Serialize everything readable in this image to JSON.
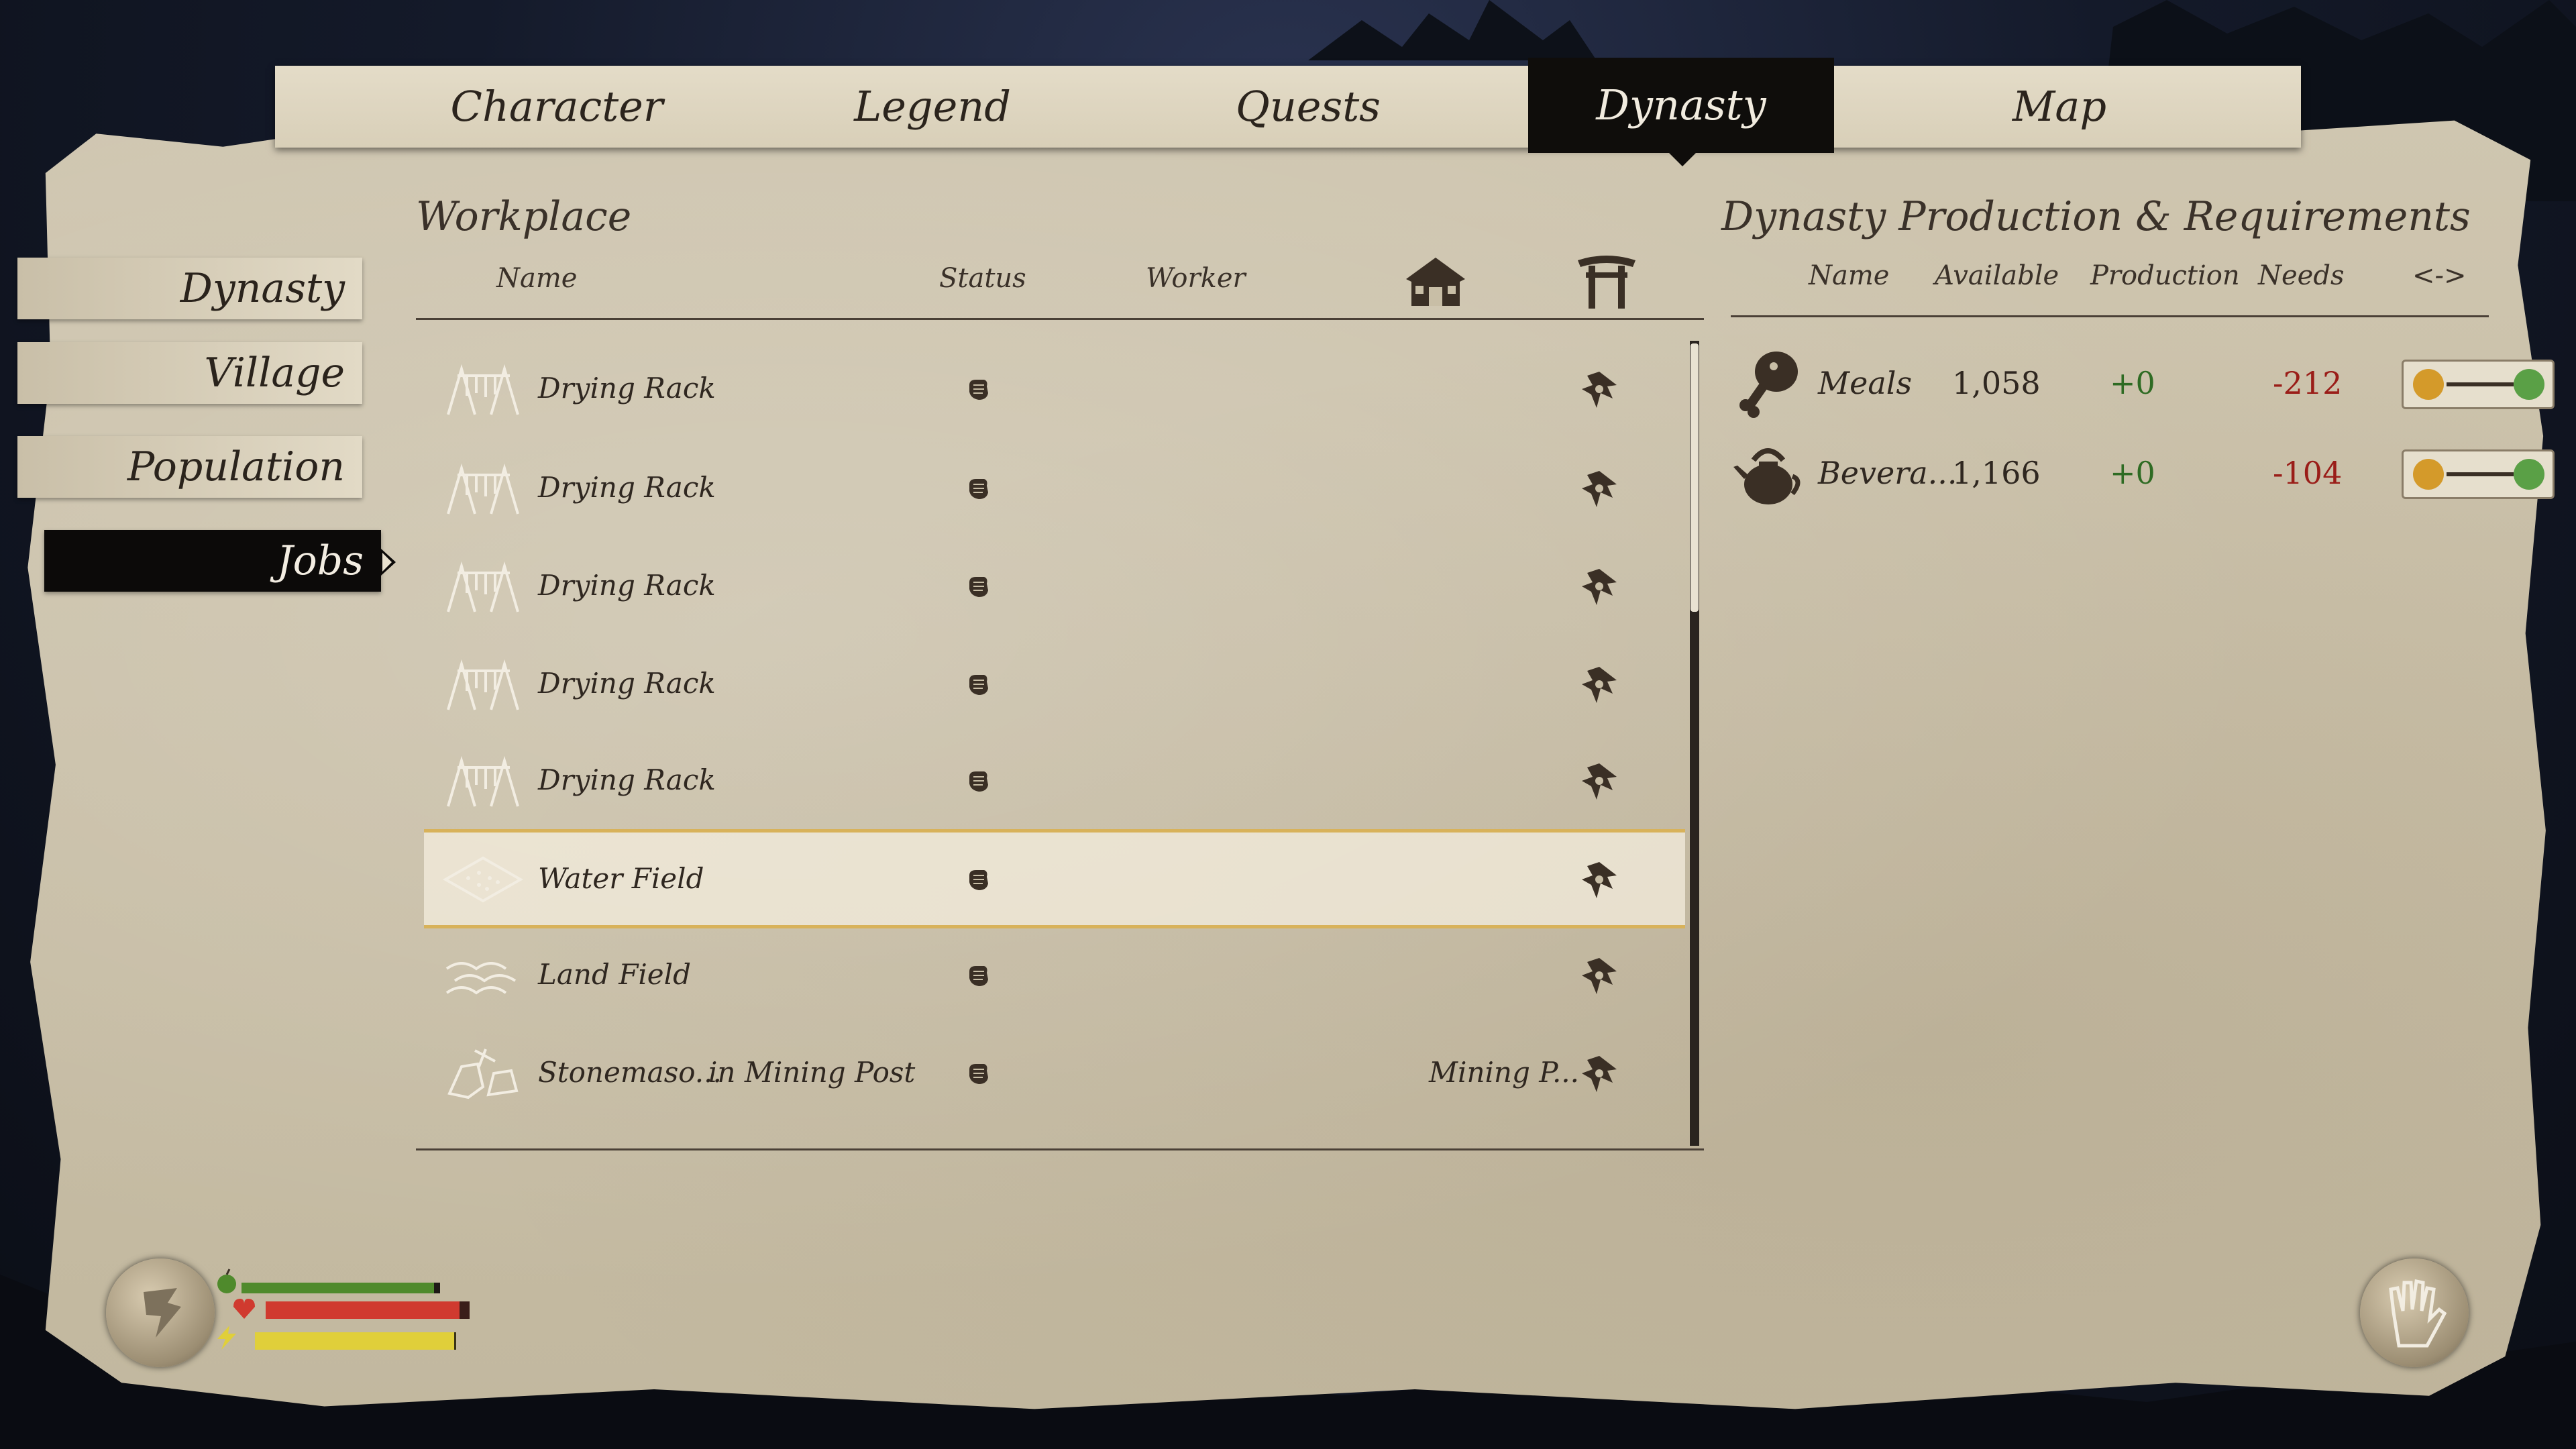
{
  "tabs": [
    {
      "label": "Character"
    },
    {
      "label": "Legend"
    },
    {
      "label": "Quests"
    },
    {
      "label": "Dynasty",
      "active": true
    },
    {
      "label": "Map"
    }
  ],
  "side_menu": [
    {
      "label": "Dynasty"
    },
    {
      "label": "Village"
    },
    {
      "label": "Population"
    },
    {
      "label": "Jobs",
      "active": true
    }
  ],
  "workplace": {
    "title": "Workplace",
    "columns": {
      "name": "Name",
      "status": "Status",
      "worker": "Worker",
      "house_icon": "house-icon",
      "gate_icon": "torii-gate-icon"
    },
    "rows": [
      {
        "icon": "drying-rack-icon",
        "name": "Drying Rack",
        "location": "",
        "worker": ""
      },
      {
        "icon": "drying-rack-icon",
        "name": "Drying Rack",
        "location": "",
        "worker": ""
      },
      {
        "icon": "drying-rack-icon",
        "name": "Drying Rack",
        "location": "",
        "worker": ""
      },
      {
        "icon": "drying-rack-icon",
        "name": "Drying Rack",
        "location": "",
        "worker": ""
      },
      {
        "icon": "drying-rack-icon",
        "name": "Drying Rack",
        "location": "",
        "worker": ""
      },
      {
        "icon": "water-field-icon",
        "name": "Water Field",
        "location": "",
        "worker": "",
        "selected": true
      },
      {
        "icon": "land-field-icon",
        "name": "Land Field",
        "location": "",
        "worker": ""
      },
      {
        "icon": "stonemason-icon",
        "name": "Stonemaso...",
        "location": "in Mining Post",
        "worker": "Mining P..."
      }
    ]
  },
  "production": {
    "title": "Dynasty Production & Requirements",
    "columns": {
      "name": "Name",
      "available": "Available",
      "production": "Production",
      "needs": "Needs",
      "swap": "<->"
    },
    "rows": [
      {
        "icon": "meat-drumstick-icon",
        "name": "Meals",
        "available": "1,058",
        "production": "+0",
        "needs": "-212"
      },
      {
        "icon": "teapot-icon",
        "name": "Bevera...",
        "available": "1,166",
        "production": "+0",
        "needs": "-104"
      }
    ]
  },
  "hud": {
    "health_fraction": 0.95,
    "food_fraction": 0.97,
    "energy_fraction": 0.99,
    "colors": {
      "health": "#d03a2f",
      "food": "#4f8a2c",
      "energy": "#e0cf3a",
      "selected_border": "#d8b25a",
      "needs": "#9a1d18",
      "production": "#2e6b23"
    }
  }
}
